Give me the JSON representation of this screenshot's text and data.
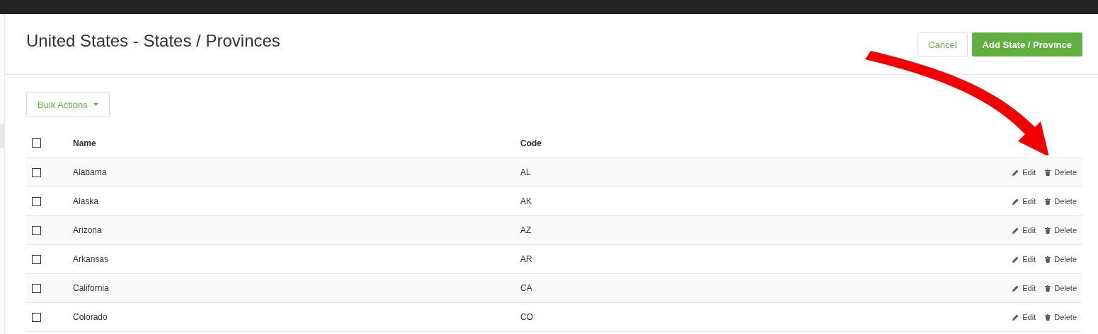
{
  "page": {
    "title": "United States - States / Provinces"
  },
  "buttons": {
    "cancel": "Cancel",
    "add": "Add State / Province"
  },
  "bulk_actions": {
    "label": "Bulk Actions"
  },
  "table": {
    "select_all": {
      "checked": false
    },
    "columns": [
      "Name",
      "Code"
    ],
    "rows": [
      {
        "name": "Alabama",
        "code": "AL",
        "checked": false,
        "edit": "Edit",
        "delete": "Delete"
      },
      {
        "name": "Alaska",
        "code": "AK",
        "checked": false,
        "edit": "Edit",
        "delete": "Delete"
      },
      {
        "name": "Arizona",
        "code": "AZ",
        "checked": false,
        "edit": "Edit",
        "delete": "Delete"
      },
      {
        "name": "Arkansas",
        "code": "AR",
        "checked": false,
        "edit": "Edit",
        "delete": "Delete"
      },
      {
        "name": "California",
        "code": "CA",
        "checked": false,
        "edit": "Edit",
        "delete": "Delete"
      },
      {
        "name": "Colorado",
        "code": "CO",
        "checked": false,
        "edit": "Edit",
        "delete": "Delete"
      }
    ]
  }
}
